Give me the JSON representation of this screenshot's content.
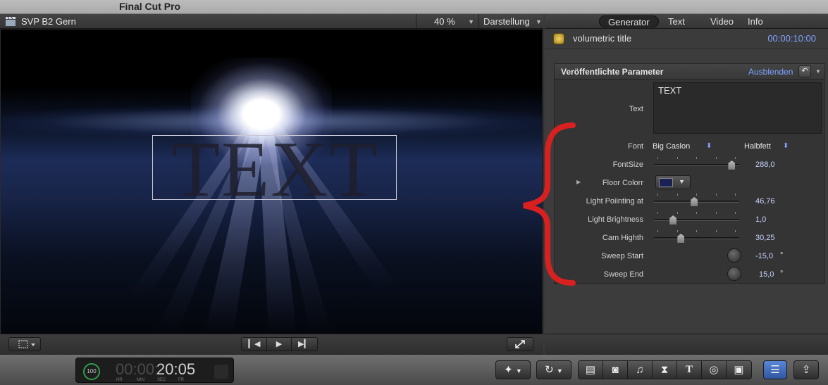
{
  "app": {
    "title": "Final Cut Pro"
  },
  "viewer": {
    "clip_name": "SVP B2 Gern",
    "zoom": "40 %",
    "view_menu": "Darstellung",
    "overlay_text": "TEXT",
    "controls": {
      "prev_icon": "skip-back-icon",
      "play_icon": "play-icon",
      "next_icon": "skip-forward-icon"
    }
  },
  "inspector": {
    "tabs": [
      "Generator",
      "Text",
      "Video",
      "Info"
    ],
    "active_tab": "Generator",
    "generator_name": "volumetric title",
    "generator_duration": "00:00:10:00",
    "params_title": "Veröffentlichte Parameter",
    "params_hide": "Ausblenden",
    "params": {
      "text": {
        "label": "Text",
        "value": "TEXT"
      },
      "font": {
        "label": "Font",
        "family": "Big Caslon",
        "style": "Halbfett"
      },
      "fontsize": {
        "label": "FontSize",
        "value": "288,0",
        "level": 0.95
      },
      "floor_color": {
        "label": "Floor Colorr",
        "color": "#1b2155"
      },
      "light_pointing": {
        "label": "Light Poiinting at",
        "value": "46,76",
        "level": 0.47
      },
      "light_brightness": {
        "label": "Light Brightness",
        "value": "1,0",
        "level": 0.2
      },
      "cam_height": {
        "label": "Cam Highth",
        "value": "30,25",
        "level": 0.3
      },
      "sweep_start": {
        "label": "Sweep Start",
        "value": "-15,0",
        "unit": "°"
      },
      "sweep_end": {
        "label": "Sweep End",
        "value": "15,0",
        "unit": "°"
      }
    }
  },
  "toolbar": {
    "gauge": "100",
    "timecode_dim": "00:00:",
    "timecode": "20:05",
    "units": [
      "HR",
      "MIN",
      "SEC",
      "FR"
    ],
    "icons": [
      "magic-wand-icon",
      "retime-icon",
      "clips-browser-icon",
      "photo-icon",
      "music-icon",
      "transitions-icon",
      "titles-icon",
      "generators-icon",
      "themes-icon",
      "inspector-icon",
      "share-icon"
    ]
  },
  "colors": {
    "accent_blue": "#7fa3ff",
    "annotation_red": "#d82020",
    "selected_button": "#3f6ec4"
  }
}
